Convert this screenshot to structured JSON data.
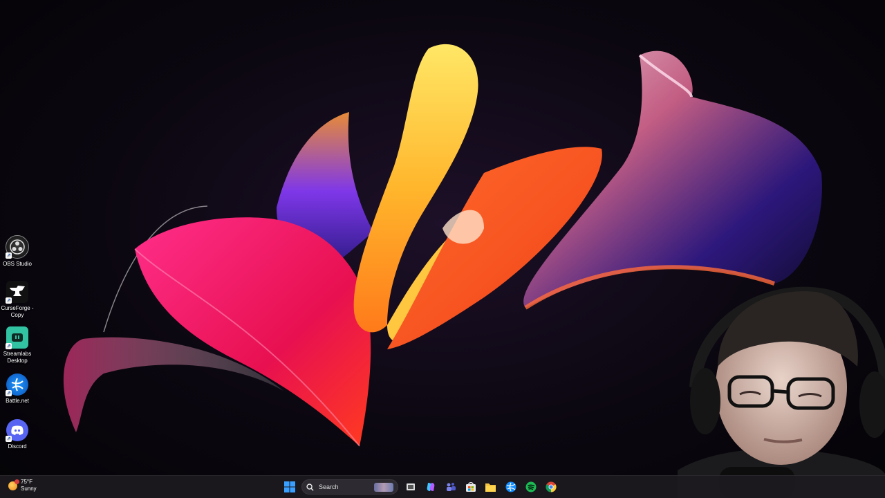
{
  "desktop": {
    "icons": [
      {
        "label": "OBS Studio",
        "icon": "obs-icon"
      },
      {
        "label": "CurseForge - Copy",
        "icon": "curseforge-icon"
      },
      {
        "label": "Streamlabs Desktop",
        "icon": "streamlabs-icon"
      },
      {
        "label": "Battle.net",
        "icon": "battlenet-icon"
      },
      {
        "label": "Discord",
        "icon": "discord-icon"
      }
    ]
  },
  "taskbar": {
    "weather": {
      "temp": "75°F",
      "condition": "Sunny"
    },
    "search": {
      "placeholder": "Search"
    },
    "pinned": [
      "start-icon",
      "search-icon",
      "task-view-icon",
      "copilot-icon",
      "teams-icon",
      "store-icon",
      "file-explorer-icon",
      "battlenet-icon",
      "spotify-icon",
      "chrome-icon"
    ]
  },
  "colors": {
    "taskbar_bg": "#1c1a1e",
    "accent": "#0078d4",
    "discord": "#5865f2",
    "streamlabs": "#31c3a2",
    "battlenet": "#148eff",
    "spotify": "#1db954"
  }
}
